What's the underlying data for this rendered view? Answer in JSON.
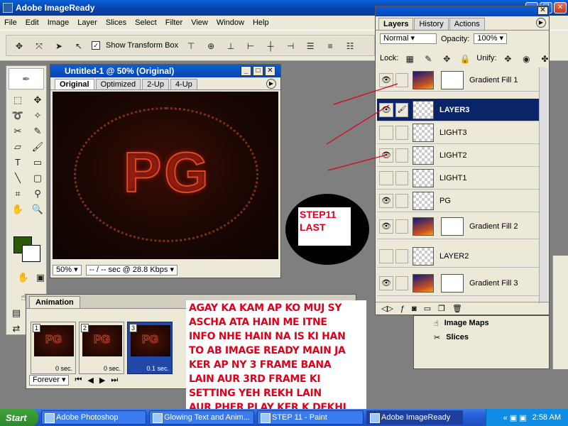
{
  "app": {
    "title": "Adobe ImageReady"
  },
  "menu": [
    "File",
    "Edit",
    "Image",
    "Layer",
    "Slices",
    "Select",
    "Filter",
    "View",
    "Window",
    "Help"
  ],
  "options": {
    "show_transform_box": "Show Transform Box"
  },
  "document": {
    "title": "Untitled-1 @ 50% (Original)",
    "tabs": [
      "Original",
      "Optimized",
      "2-Up",
      "4-Up"
    ],
    "canvas_text": "PG",
    "zoom": "50%",
    "status": "-- / -- sec @ 28.8 Kbps"
  },
  "animation": {
    "tab": "Animation",
    "frames": [
      {
        "num": "1",
        "delay": "0 sec.",
        "thumb": "PG"
      },
      {
        "num": "2",
        "delay": "0 sec.",
        "thumb": "PG"
      },
      {
        "num": "3",
        "delay": "0.1 sec.",
        "thumb": "PG"
      }
    ],
    "loop": "Forever"
  },
  "note": {
    "text_lines": [
      "AGAY KA KAM AP KO MUJ SY",
      "ASCHA ATA HAIN ME ITNE",
      "INFO NHE HAIN NA IS KI HAN",
      "TO AB IMAGE READY MAIN JA",
      "KER AP NY 3 FRAME BANA",
      "LAIN AUR 3RD FRAME KI",
      "SETTING YEH REKH LAIN",
      "AUR PHER PLAY KER K DEKHI"
    ],
    "color": "#e0001a"
  },
  "step_label": {
    "line1": "STEP11",
    "line2": "LAST"
  },
  "layers": {
    "tabs": [
      "Layers",
      "History",
      "Actions"
    ],
    "blend_mode": "Normal",
    "opacity_label": "Opacity:",
    "opacity": "100%",
    "lock_label": "Lock:",
    "unify_label": "Unify:",
    "rows": [
      {
        "name": "Gradient Fill 1",
        "kind": "grad"
      },
      {
        "name": "LAYER3",
        "kind": "trans"
      },
      {
        "name": "LIGHT3",
        "kind": "trans"
      },
      {
        "name": "LIGHT2",
        "kind": "trans"
      },
      {
        "name": "LIGHT1",
        "kind": "trans"
      },
      {
        "name": "PG",
        "kind": "trans"
      },
      {
        "name": "Gradient Fill 2",
        "kind": "grad"
      },
      {
        "name": "LAYER2",
        "kind": "trans"
      },
      {
        "name": "Gradient Fill 3",
        "kind": "grad"
      }
    ],
    "selected": "LAYER3"
  },
  "maps_panel": {
    "image_maps": "Image Maps",
    "slices": "Slices"
  },
  "taskbar": {
    "start": "Start",
    "tasks": [
      "Adobe Photoshop",
      "Glowing Text and Anim...",
      "STEP 11 - Paint",
      "Adobe ImageReady"
    ],
    "clock": "2:58 AM"
  }
}
